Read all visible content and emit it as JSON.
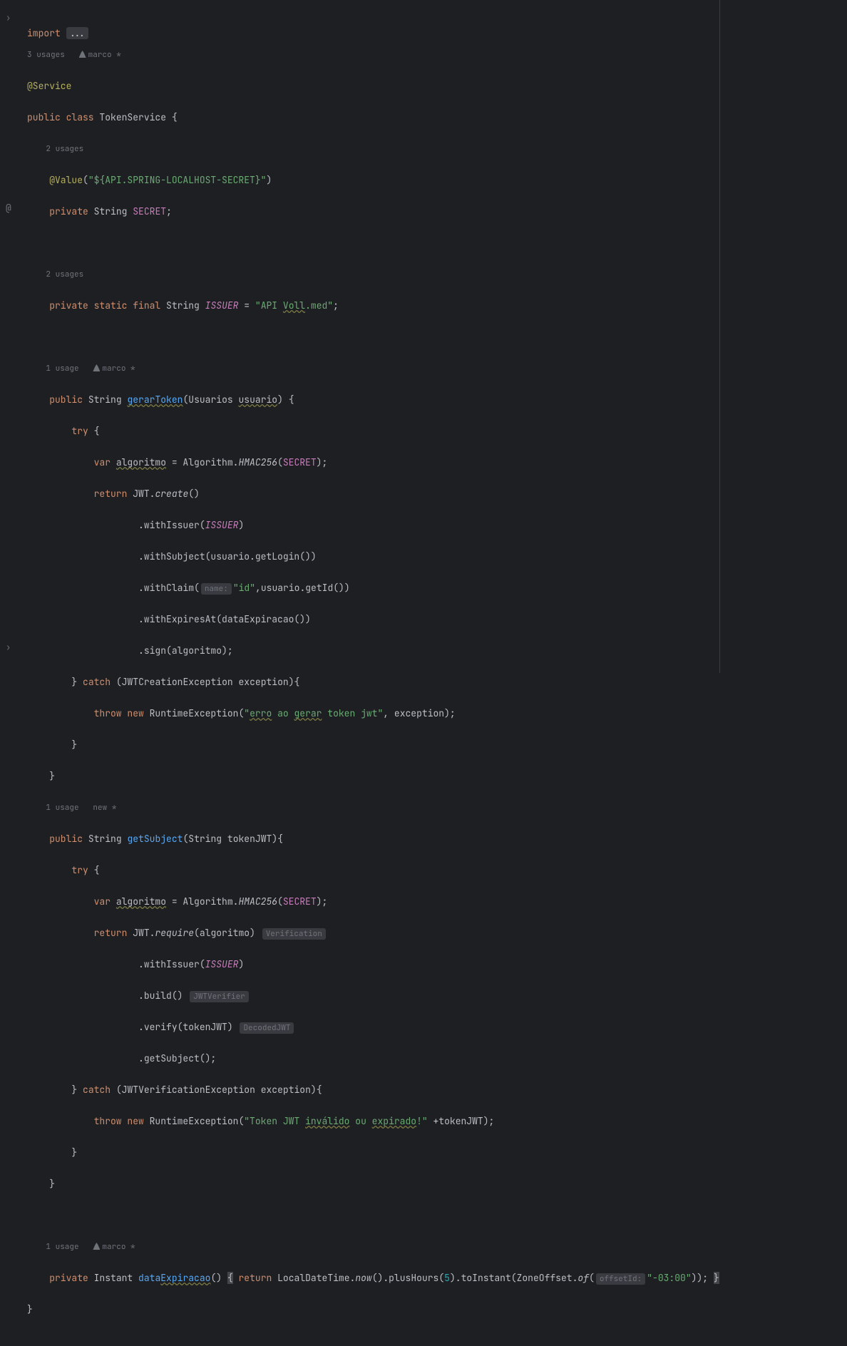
{
  "imports": {
    "keyword": "import",
    "ellipsis": "..."
  },
  "class_header": {
    "usages": "3 usages",
    "author": "marco *",
    "annotation": "@Service",
    "modifiers": "public class",
    "name": "TokenService",
    "brace": "{"
  },
  "secret_field": {
    "usages": "2 usages",
    "ann_name": "@Value",
    "ann_open": "(",
    "ann_val": "\"${API.SPRING-LOCALHOST-SECRET}\"",
    "ann_close": ")",
    "mods": "private",
    "type": "String",
    "name": "SECRET",
    "semi": ";"
  },
  "issuer_field": {
    "usages": "2 usages",
    "mods1": "private",
    "mods2": "static final",
    "type": "String",
    "name": "ISSUER",
    "eq": " = ",
    "q1": "\"API ",
    "voll": "Voll",
    "q2": ".med\"",
    "semi": ";"
  },
  "gerarToken": {
    "usages": "1 usage",
    "author": "marco *",
    "mods": "public",
    "ret": "String",
    "name": "gerarToken",
    "paren_o": "(",
    "param_type": "Usuarios",
    "param_name": "usuario",
    "paren_c": ")",
    "brace": "{",
    "try_kw": "try",
    "try_brace": "{",
    "var_kw": "var",
    "algo_name": "algoritmo",
    "algo_eq": " = Algorithm.",
    "hmac": "HMAC256",
    "algo_open": "(",
    "secret_ref": "SECRET",
    "algo_close": ")",
    "algo_semi": ";",
    "return_kw": "return",
    "jwt": " JWT.",
    "create": "create",
    "create_p": "()",
    "wi": ".withIssuer(",
    "issuer_ref": "ISSUER",
    "wi_close": ")",
    "ws": ".withSubject(",
    "ws_arg1": "usuario",
    "ws_arg2": ".getLogin()",
    "ws_close": ")",
    "wc": ".withClaim(",
    "wc_hint": "name:",
    "wc_id": "\"id\"",
    "wc_comma": ",",
    "wc_arg1": "usuario",
    "wc_arg2": ".getId()",
    "wc_close": ")",
    "we": ".withExpiresAt(dataExpiracao()",
    "we_close": ")",
    "sign": ".sign(algoritmo",
    "sign_close": ")",
    "sign_semi": ";",
    "catch_close": "}",
    "catch_kw": "catch",
    "catch_open": "(",
    "exc_type": "JWTCreationException",
    "exc_name": "exception",
    "catch_paren_c": ")",
    "catch_brace": "{",
    "throw_kw": "throw new",
    "rte": "RuntimeException",
    "throw_open": "(",
    "err_q1": "\"",
    "err_w1": "erro",
    "err_m1": " ao ",
    "err_w2": "gerar",
    "err_m2": " token jwt\"",
    "throw_comma": ", exception",
    "throw_close": ")",
    "throw_semi": ";",
    "catch_end": "}",
    "method_end": "}"
  },
  "getSubject": {
    "usages": "1 usage",
    "author": "new *",
    "mods": "public",
    "ret": "String",
    "name": "getSubject",
    "paren_o": "(",
    "param_type": "String",
    "param_name": "tokenJWT",
    "paren_c": ")",
    "brace": "{",
    "try_kw": "try",
    "try_brace": "{",
    "var_kw": "var",
    "algo_name": "algoritmo",
    "algo_eq": " = Algorithm.",
    "hmac": "HMAC256",
    "algo_open": "(",
    "secret_ref": "SECRET",
    "algo_close": ")",
    "algo_semi": ";",
    "return_kw": "return",
    "jwt": " JWT.",
    "require": "require",
    "req_open": "(",
    "req_arg": "algoritmo",
    "req_close": ")",
    "hint_ver": "Verification",
    "wi": ".withIssuer(",
    "issuer_ref": "ISSUER",
    "wi_close": ")",
    "build": ".build()",
    "hint_jwtv": "JWTVerifier",
    "verify": ".verify(tokenJWT",
    "verify_close": ")",
    "hint_dec": "DecodedJWT",
    "gs": ".getSubject()",
    "gs_semi": ";",
    "catch_close": "}",
    "catch_kw": "catch",
    "catch_open": "(",
    "exc_type": "JWTVerificationException",
    "exc_name": "exception",
    "catch_paren_c": ")",
    "catch_brace": "{",
    "throw_kw": "throw new",
    "rte": "RuntimeException",
    "throw_open": "(",
    "err_q1": "\"Token JWT ",
    "err_w1": "inválido",
    "err_m1": " ou ",
    "err_w2": "expirado",
    "err_m2": "!\"",
    "throw_plus": " +tokenJWT",
    "throw_close": ")",
    "throw_semi": ";",
    "catch_end": "}",
    "method_end": "}"
  },
  "dataExp": {
    "usages": "1 usage",
    "author": "marco *",
    "mods": "private",
    "ret": "Instant",
    "name_pre": "data",
    "name_warn": "Expiracao",
    "paren": "()",
    "brace_o": "{",
    "return_kw": "return",
    "ldt": " LocalDateTime.",
    "now": "now",
    "now_p": "()",
    "plus": ".plusHours(",
    "five": "5",
    "plus_c": ")",
    "toInst": ".toInstant(ZoneOffset.",
    "of": "of",
    "of_open": "(",
    "hint_off": "offsetId:",
    "off_str": "\"-03:00\"",
    "of_close": "))",
    "semi": ";",
    "brace_c": "}"
  },
  "class_close": "}"
}
